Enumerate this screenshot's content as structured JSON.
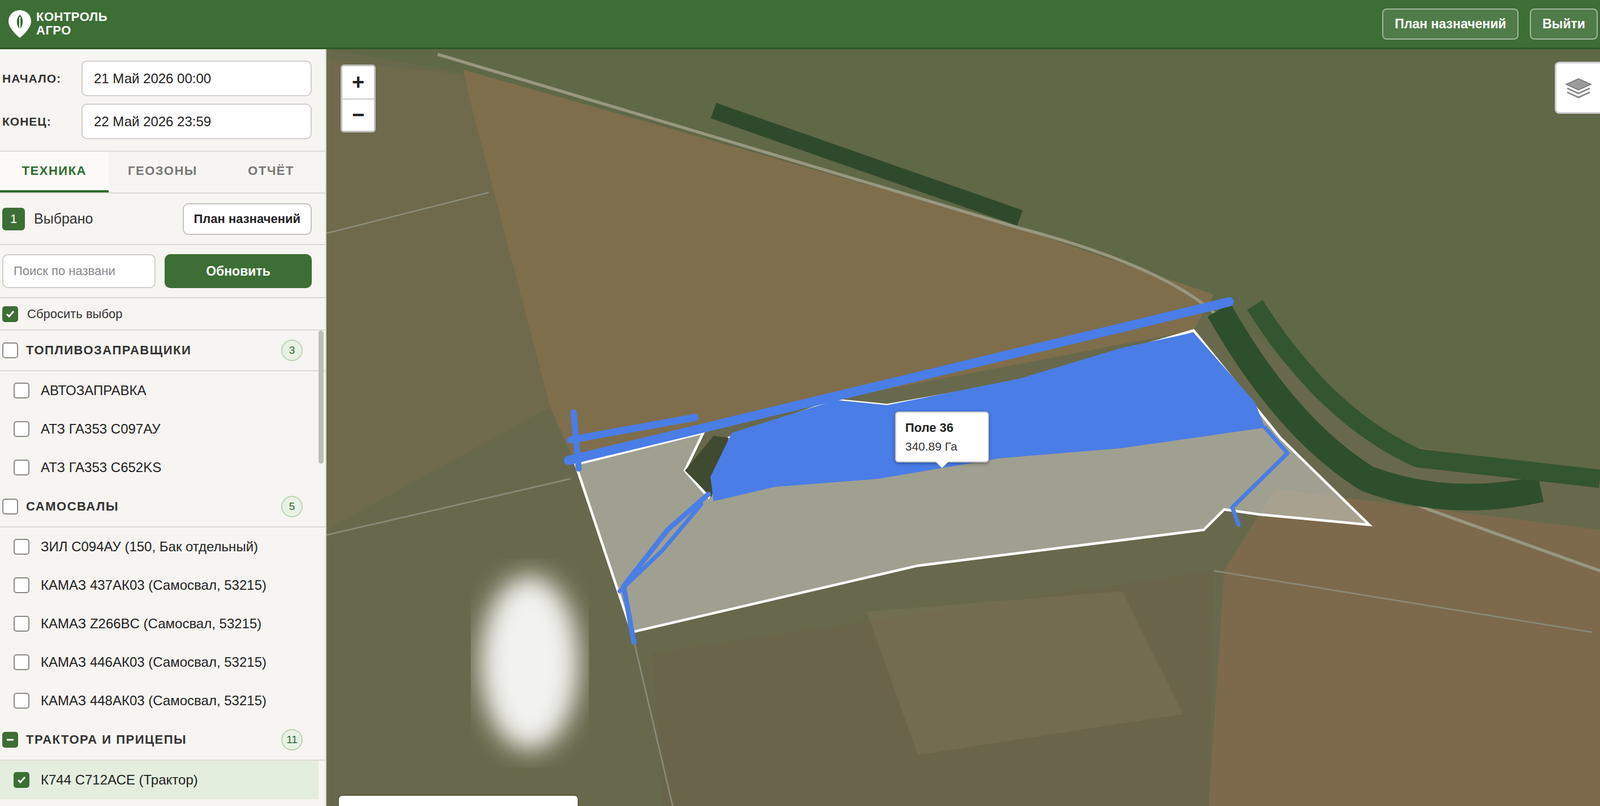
{
  "header": {
    "logo": [
      "КОНТРОЛЬ",
      "АГРО"
    ],
    "buttons": [
      "План назначений",
      "Выйти"
    ]
  },
  "period": [
    {
      "label": "НАЧАЛО:",
      "value": "21 Май 2026 00:00"
    },
    {
      "label": "КОНЕЦ:",
      "value": "22 Май 2026 23:59"
    }
  ],
  "tabs": [
    {
      "label": "ТЕХНИКА",
      "selected": true
    },
    {
      "label": "ГЕОЗОНЫ",
      "selected": false
    },
    {
      "label": "ОТЧЁТ",
      "selected": false
    }
  ],
  "selection": {
    "count": "1",
    "label": "Выбрано",
    "button": "План назначений"
  },
  "search": {
    "placeholder": "Поиск по названи",
    "button": "Обновить"
  },
  "reset": {
    "label": "Сбросить выбор",
    "checked": true
  },
  "groups": [
    {
      "name": "ТОПЛИВОЗАПРАВЩИКИ",
      "count": "3",
      "checked": false,
      "indeterminate": false,
      "items": [
        {
          "name": "АВТОЗАПРАВКА",
          "checked": false,
          "selected": false
        },
        {
          "name": "АТЗ ГА353 С097АУ",
          "checked": false,
          "selected": false
        },
        {
          "name": "АТЗ ГА353 С652KS",
          "checked": false,
          "selected": false
        }
      ]
    },
    {
      "name": "САМОСВАЛЫ",
      "count": "5",
      "checked": false,
      "indeterminate": false,
      "items": [
        {
          "name": "ЗИЛ С094АУ (150, Бак отдельный)",
          "checked": false,
          "selected": false
        },
        {
          "name": "КАМАЗ 437АК03 (Самосвал, 53215)",
          "checked": false,
          "selected": false
        },
        {
          "name": "КАМАЗ Z266BC (Самосвал, 53215)",
          "checked": false,
          "selected": false
        },
        {
          "name": "КАМАЗ 446АК03 (Самосвал, 53215)",
          "checked": false,
          "selected": false
        },
        {
          "name": "КАМАЗ 448АК03 (Самосвал, 53215)",
          "checked": false,
          "selected": false
        }
      ]
    },
    {
      "name": "ТРАКТОРА И ПРИЦЕПЫ",
      "count": "11",
      "checked": false,
      "indeterminate": true,
      "items": [
        {
          "name": "К744 С712АСЕ (Трактор)",
          "checked": true,
          "selected": true
        }
      ]
    }
  ],
  "map": {
    "zoom": [
      "+",
      "−"
    ],
    "tooltip": {
      "title": "Поле 36",
      "area": "340.89 Га"
    }
  }
}
